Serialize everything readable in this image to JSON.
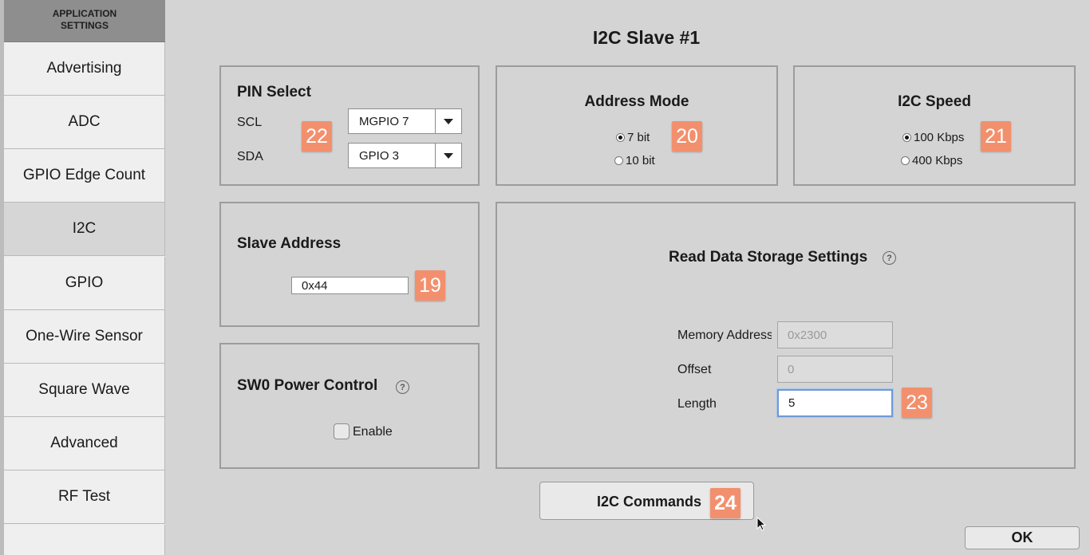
{
  "sidebar": {
    "header": "APPLICATION SETTINGS",
    "items": [
      {
        "label": "Advertising"
      },
      {
        "label": "ADC"
      },
      {
        "label": "GPIO Edge Count"
      },
      {
        "label": "I2C",
        "selected": true
      },
      {
        "label": "GPIO"
      },
      {
        "label": "One-Wire Sensor"
      },
      {
        "label": "Square Wave"
      },
      {
        "label": "Advanced"
      },
      {
        "label": "RF Test"
      }
    ]
  },
  "page": {
    "title": "I2C Slave #1"
  },
  "pin_select": {
    "title": "PIN Select",
    "scl_label": "SCL",
    "sda_label": "SDA",
    "scl_value": "MGPIO 7",
    "sda_value": "GPIO 3",
    "badge": "22"
  },
  "address_mode": {
    "title": "Address Mode",
    "options": [
      {
        "label": "7 bit",
        "selected": true
      },
      {
        "label": "10 bit",
        "selected": false
      }
    ],
    "badge": "20"
  },
  "i2c_speed": {
    "title": "I2C Speed",
    "options": [
      {
        "label": "100 Kbps",
        "selected": true
      },
      {
        "label": "400 Kbps",
        "selected": false
      }
    ],
    "badge": "21"
  },
  "slave_address": {
    "title": "Slave Address",
    "value": "0x44",
    "badge": "19"
  },
  "sw0_power": {
    "title": "SW0 Power Control",
    "help": "?",
    "enable_label": "Enable",
    "checked": false
  },
  "read_data": {
    "title": "Read Data Storage Settings",
    "help": "?",
    "memory_address_label": "Memory Address",
    "memory_address_value": "0x2300",
    "offset_label": "Offset",
    "offset_value": "0",
    "length_label": "Length",
    "length_value": "5",
    "badge": "23"
  },
  "commands": {
    "label": "I2C Commands",
    "badge": "24"
  },
  "footer": {
    "ok_label": "OK"
  }
}
